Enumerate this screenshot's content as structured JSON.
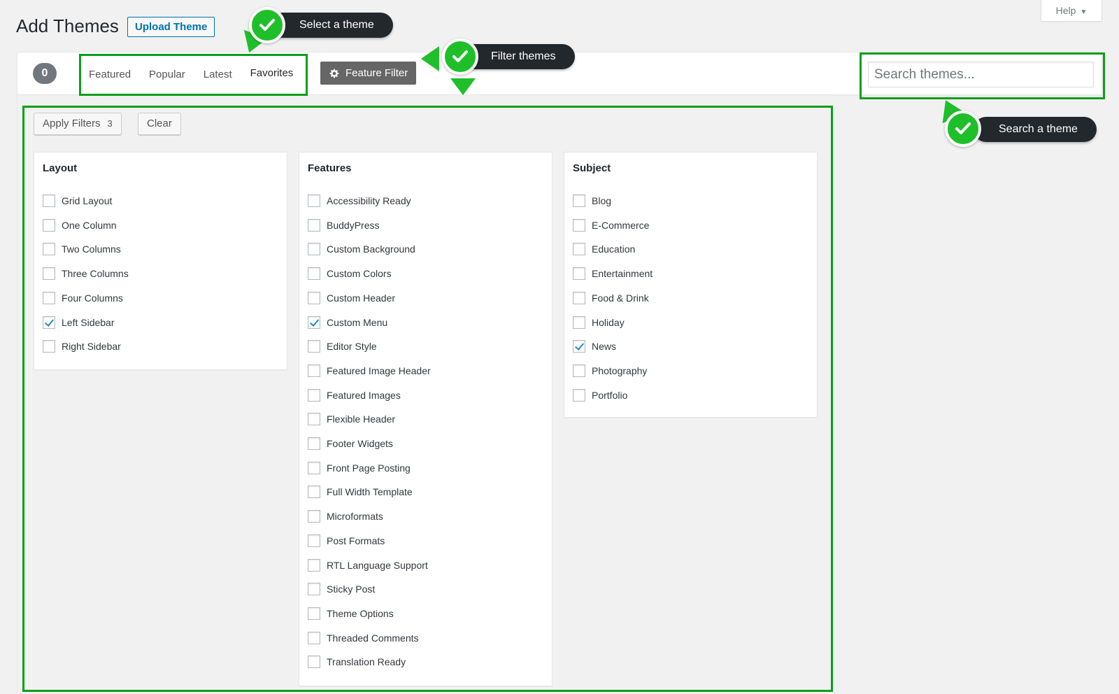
{
  "header": {
    "title": "Add Themes",
    "upload_label": "Upload Theme",
    "help_label": "Help"
  },
  "filter_bar": {
    "count": "0",
    "tabs": [
      {
        "label": "Featured"
      },
      {
        "label": "Popular"
      },
      {
        "label": "Latest"
      },
      {
        "label": "Favorites"
      }
    ],
    "feature_filter_label": "Feature Filter",
    "search_placeholder": "Search themes..."
  },
  "actions": {
    "apply_label": "Apply Filters",
    "apply_count": "3",
    "clear_label": "Clear"
  },
  "groups": {
    "layout": {
      "title": "Layout",
      "options": [
        {
          "label": "Grid Layout",
          "checked": false
        },
        {
          "label": "One Column",
          "checked": false
        },
        {
          "label": "Two Columns",
          "checked": false
        },
        {
          "label": "Three Columns",
          "checked": false
        },
        {
          "label": "Four Columns",
          "checked": false
        },
        {
          "label": "Left Sidebar",
          "checked": true
        },
        {
          "label": "Right Sidebar",
          "checked": false
        }
      ]
    },
    "features": {
      "title": "Features",
      "options": [
        {
          "label": "Accessibility Ready",
          "checked": false
        },
        {
          "label": "BuddyPress",
          "checked": false
        },
        {
          "label": "Custom Background",
          "checked": false
        },
        {
          "label": "Custom Colors",
          "checked": false
        },
        {
          "label": "Custom Header",
          "checked": false
        },
        {
          "label": "Custom Menu",
          "checked": true
        },
        {
          "label": "Editor Style",
          "checked": false
        },
        {
          "label": "Featured Image Header",
          "checked": false
        },
        {
          "label": "Featured Images",
          "checked": false
        },
        {
          "label": "Flexible Header",
          "checked": false
        },
        {
          "label": "Footer Widgets",
          "checked": false
        },
        {
          "label": "Front Page Posting",
          "checked": false
        },
        {
          "label": "Full Width Template",
          "checked": false
        },
        {
          "label": "Microformats",
          "checked": false
        },
        {
          "label": "Post Formats",
          "checked": false
        },
        {
          "label": "RTL Language Support",
          "checked": false
        },
        {
          "label": "Sticky Post",
          "checked": false
        },
        {
          "label": "Theme Options",
          "checked": false
        },
        {
          "label": "Threaded Comments",
          "checked": false
        },
        {
          "label": "Translation Ready",
          "checked": false
        }
      ]
    },
    "subject": {
      "title": "Subject",
      "options": [
        {
          "label": "Blog",
          "checked": false
        },
        {
          "label": "E-Commerce",
          "checked": false
        },
        {
          "label": "Education",
          "checked": false
        },
        {
          "label": "Entertainment",
          "checked": false
        },
        {
          "label": "Food & Drink",
          "checked": false
        },
        {
          "label": "Holiday",
          "checked": false
        },
        {
          "label": "News",
          "checked": true
        },
        {
          "label": "Photography",
          "checked": false
        },
        {
          "label": "Portfolio",
          "checked": false
        }
      ]
    }
  },
  "callouts": {
    "select": "Select a theme",
    "filter": "Filter themes",
    "search": "Search a theme"
  },
  "colors": {
    "highlight": "#0a9f1a",
    "check_green": "#1fbf2a",
    "callout_bg": "#23282d",
    "link_blue": "#0073aa"
  }
}
